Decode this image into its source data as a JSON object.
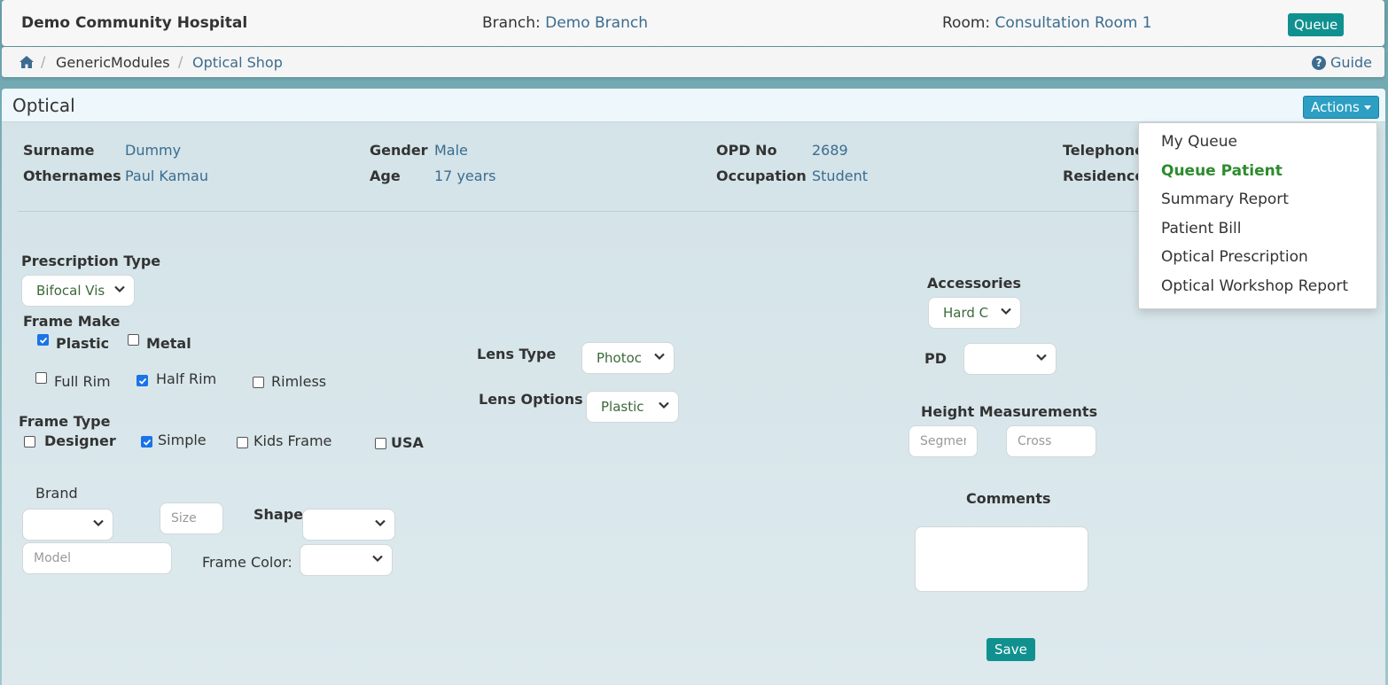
{
  "header": {
    "hospital": "Demo Community Hospital",
    "branch_label": "Branch:",
    "branch_value": "Demo Branch",
    "room_label": "Room:",
    "room_value": "Consultation Room 1",
    "queue_button": "Queue"
  },
  "breadcrumb": {
    "items": [
      "GenericModules",
      "Optical Shop"
    ],
    "separator": "/",
    "guide_label": "Guide"
  },
  "panel": {
    "title": "Optical",
    "actions_button": "Actions"
  },
  "actions_menu": {
    "items": [
      "My Queue",
      "Queue Patient",
      "Summary Report",
      "Patient Bill",
      "Optical Prescription",
      "Optical Workshop Report"
    ],
    "active_item": "Queue Patient"
  },
  "patient": {
    "surname_label": "Surname",
    "surname": "Dummy",
    "othernames_label": "Othernames",
    "othernames": "Paul Kamau",
    "gender_label": "Gender",
    "gender": "Male",
    "age_label": "Age",
    "age": "17 years",
    "opd_label": "OPD No",
    "opd": "2689",
    "occupation_label": "Occupation",
    "occupation": "Student",
    "telephone_label": "Telephone",
    "residence_label": "Residence"
  },
  "form": {
    "prescription_type_label": "Prescription Type",
    "prescription_type_value": "Bifocal Vis",
    "frame_make_label": "Frame Make",
    "frame_make_options": [
      {
        "label": "Plastic",
        "checked": true
      },
      {
        "label": "Metal",
        "checked": false
      }
    ],
    "rim_options": [
      {
        "label": "Full Rim",
        "checked": false
      },
      {
        "label": "Half Rim",
        "checked": true
      },
      {
        "label": "Rimless",
        "checked": false
      }
    ],
    "frame_type_label": "Frame Type",
    "frame_type_options": [
      {
        "label": "Designer",
        "checked": false
      },
      {
        "label": "Simple",
        "checked": true
      },
      {
        "label": "Kids Frame",
        "checked": false
      },
      {
        "label": "USA",
        "checked": false
      }
    ],
    "brand_label": "Brand",
    "brand_value": "",
    "size_placeholder": "Size",
    "model_placeholder": "Model",
    "shape_label": "Shape:",
    "shape_value": "",
    "frame_color_label": "Frame Color:",
    "frame_color_value": "",
    "lens_type_label": "Lens Type",
    "lens_type_value": "Photoc",
    "lens_options_label": "Lens Options",
    "lens_options_value": "Plastic",
    "accessories_label": "Accessories",
    "accessories_value": "Hard C",
    "pd_label": "PD",
    "pd_value": "",
    "height_label": "Height Measurements",
    "segment_placeholder": "Segment",
    "cross_placeholder": "Cross",
    "comments_label": "Comments",
    "save_button": "Save"
  },
  "icons": {
    "home": "home-icon",
    "guide": "question-circle-icon",
    "select": "chevron-down-icon",
    "check": "check-icon"
  },
  "colors": {
    "teal_button": "#10918f",
    "actions_button": "#2c9fc3",
    "link": "#3b6c8f",
    "active_menu": "#2e8b2e"
  }
}
